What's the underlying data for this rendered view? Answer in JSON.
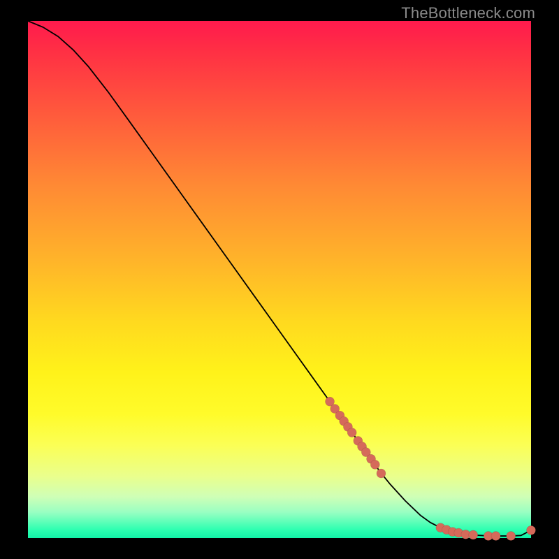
{
  "watermark": "TheBottleneck.com",
  "colors": {
    "point": "#d56a5a",
    "curve": "#000000"
  },
  "chart_data": {
    "type": "line",
    "title": "",
    "xlabel": "",
    "ylabel": "",
    "xlim": [
      0,
      100
    ],
    "ylim": [
      0,
      100
    ],
    "grid": false,
    "series": [
      {
        "name": "curve",
        "x": [
          0,
          3,
          6,
          9,
          12,
          16,
          20,
          25,
          30,
          35,
          40,
          45,
          50,
          55,
          60,
          65,
          70,
          72,
          75,
          78,
          80,
          82,
          84,
          86,
          88,
          90,
          92,
          94,
          96,
          98,
          100
        ],
        "y": [
          100,
          98.8,
          97.0,
          94.4,
          91.2,
          86.2,
          80.8,
          74.0,
          67.2,
          60.4,
          53.6,
          46.8,
          40.0,
          33.2,
          26.4,
          19.6,
          12.8,
          10.4,
          7.2,
          4.4,
          3.0,
          2.0,
          1.3,
          0.9,
          0.6,
          0.5,
          0.4,
          0.4,
          0.4,
          0.5,
          1.5
        ]
      }
    ],
    "mid_cluster_points": [
      {
        "x": 60.0,
        "y": 26.4
      },
      {
        "x": 61.0,
        "y": 25.0
      },
      {
        "x": 62.0,
        "y": 23.7
      },
      {
        "x": 62.8,
        "y": 22.6
      },
      {
        "x": 63.6,
        "y": 21.5
      },
      {
        "x": 64.4,
        "y": 20.4
      },
      {
        "x": 65.6,
        "y": 18.8
      },
      {
        "x": 66.4,
        "y": 17.7
      },
      {
        "x": 67.2,
        "y": 16.6
      },
      {
        "x": 68.2,
        "y": 15.3
      },
      {
        "x": 69.0,
        "y": 14.2
      },
      {
        "x": 70.2,
        "y": 12.5
      }
    ],
    "bottom_cluster_points": [
      {
        "x": 82.0,
        "y": 2.0
      },
      {
        "x": 83.2,
        "y": 1.6
      },
      {
        "x": 84.4,
        "y": 1.2
      },
      {
        "x": 85.6,
        "y": 1.0
      },
      {
        "x": 87.0,
        "y": 0.7
      },
      {
        "x": 88.5,
        "y": 0.6
      },
      {
        "x": 91.5,
        "y": 0.4
      },
      {
        "x": 93.0,
        "y": 0.4
      },
      {
        "x": 96.0,
        "y": 0.4
      },
      {
        "x": 100.0,
        "y": 1.5
      }
    ]
  }
}
